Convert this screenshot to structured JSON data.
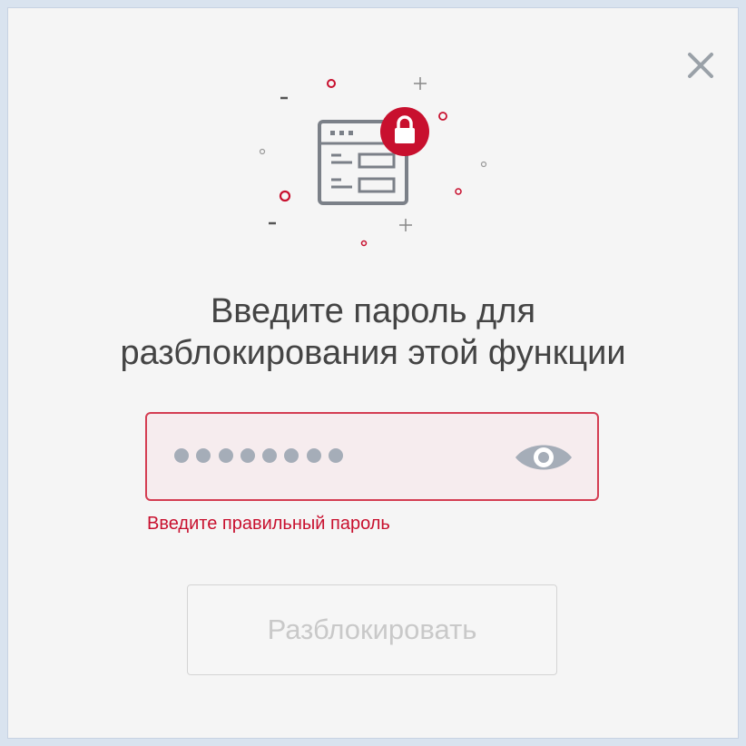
{
  "dialog": {
    "title_line1": "Введите пароль для",
    "title_line2": "разблокирования этой функции",
    "password": {
      "masked_length": 8,
      "show_icon": "eye-icon"
    },
    "error_text": "Введите правильный пароль",
    "unlock_button": {
      "label": "Разблокировать",
      "disabled": true
    },
    "close_icon": "close-icon",
    "illustration_icon": "locked-window-icon"
  },
  "colors": {
    "accent": "#c8102e",
    "error": "#c8102e",
    "field_border": "#d43d52",
    "field_bg": "#f6ecee",
    "text": "#444444"
  }
}
